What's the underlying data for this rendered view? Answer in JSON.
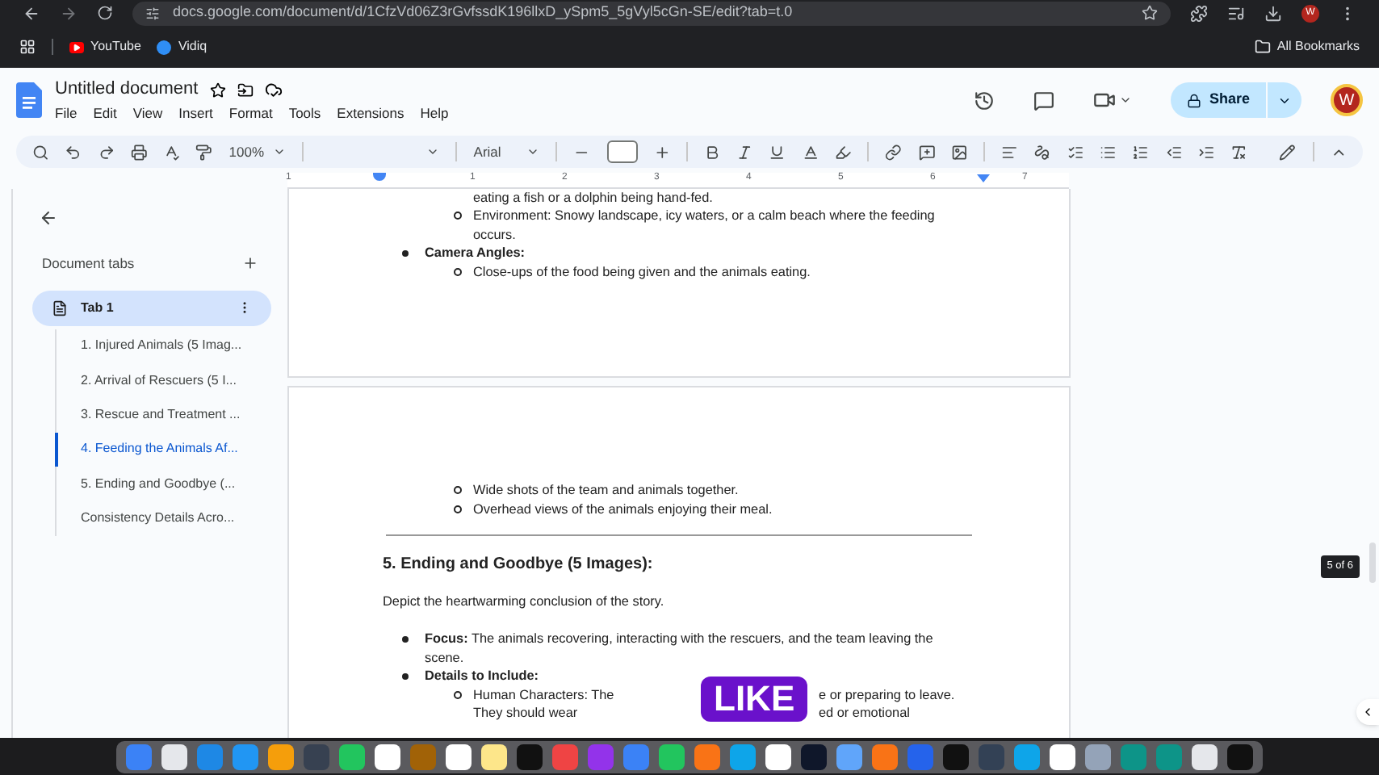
{
  "browser": {
    "url": "docs.google.com/document/d/1CfzVd06Z3rGvfssdK196llxD_ySpm5_5gVyl5cGn-SE/edit?tab=t.0",
    "profile": "W",
    "bookmarks": [
      {
        "label": "YouTube",
        "kind": "youtube"
      },
      {
        "label": "Vidiq",
        "kind": "vidiq"
      }
    ],
    "all_bookmarks": "All Bookmarks"
  },
  "docs": {
    "title": "Untitled document",
    "menu": [
      "File",
      "Edit",
      "View",
      "Insert",
      "Format",
      "Tools",
      "Extensions",
      "Help"
    ],
    "share": "Share",
    "avatar": "W"
  },
  "toolbar": {
    "zoom": "100%",
    "font": "Arial"
  },
  "ruler": [
    "1",
    "1",
    "2",
    "3",
    "4",
    "5",
    "6",
    "7"
  ],
  "sidebar": {
    "heading": "Document tabs",
    "tab": {
      "label": "Tab 1",
      "selected": true
    },
    "outline": [
      {
        "label": "1. Injured Animals (5 Imag...",
        "selected": false
      },
      {
        "label": "2. Arrival of Rescuers (5 I...",
        "selected": false
      },
      {
        "label": "3. Rescue and Treatment ...",
        "selected": false
      },
      {
        "label": "4. Feeding the Animals Af...",
        "selected": true
      },
      {
        "label": "5. Ending and Goodbye (...",
        "selected": false
      },
      {
        "label": "Consistency Details Acro...",
        "selected": false
      }
    ]
  },
  "pages": [
    {
      "blocks": [
        {
          "kind": "continuation",
          "text": "eating a fish or a dolphin being hand-fed."
        },
        {
          "kind": "sub_bullet",
          "text": "Environment: Snowy landscape, icy waters, or a calm beach where the feeding occurs."
        },
        {
          "kind": "bullet",
          "label": "Camera Angles:"
        },
        {
          "kind": "sub_bullet",
          "text": "Close-ups of the food being given and the animals eating."
        }
      ]
    },
    {
      "blocks": [
        {
          "kind": "sub_bullet",
          "text": "Wide shots of the team and animals together."
        },
        {
          "kind": "sub_bullet",
          "text": "Overhead views of the animals enjoying their meal."
        },
        {
          "kind": "rule"
        },
        {
          "kind": "heading",
          "text": "5. Ending and Goodbye (5 Images):"
        },
        {
          "kind": "paragraph",
          "text": "Depict the heartwarming conclusion of the story."
        },
        {
          "kind": "bullet",
          "label": "Focus:",
          "text": "The animals recovering, interacting with the rescuers, and the team leaving the scene."
        },
        {
          "kind": "bullet",
          "label": "Details to Include:"
        },
        {
          "kind": "covered",
          "lines": [
            {
              "left": "Human Characters: The",
              "right": "e or preparing to leave."
            },
            {
              "left": "They should wear",
              "right": "ed or emotional"
            }
          ]
        }
      ]
    }
  ],
  "overlay": {
    "label": "LIKE"
  },
  "page_counter": "5 of 6"
}
